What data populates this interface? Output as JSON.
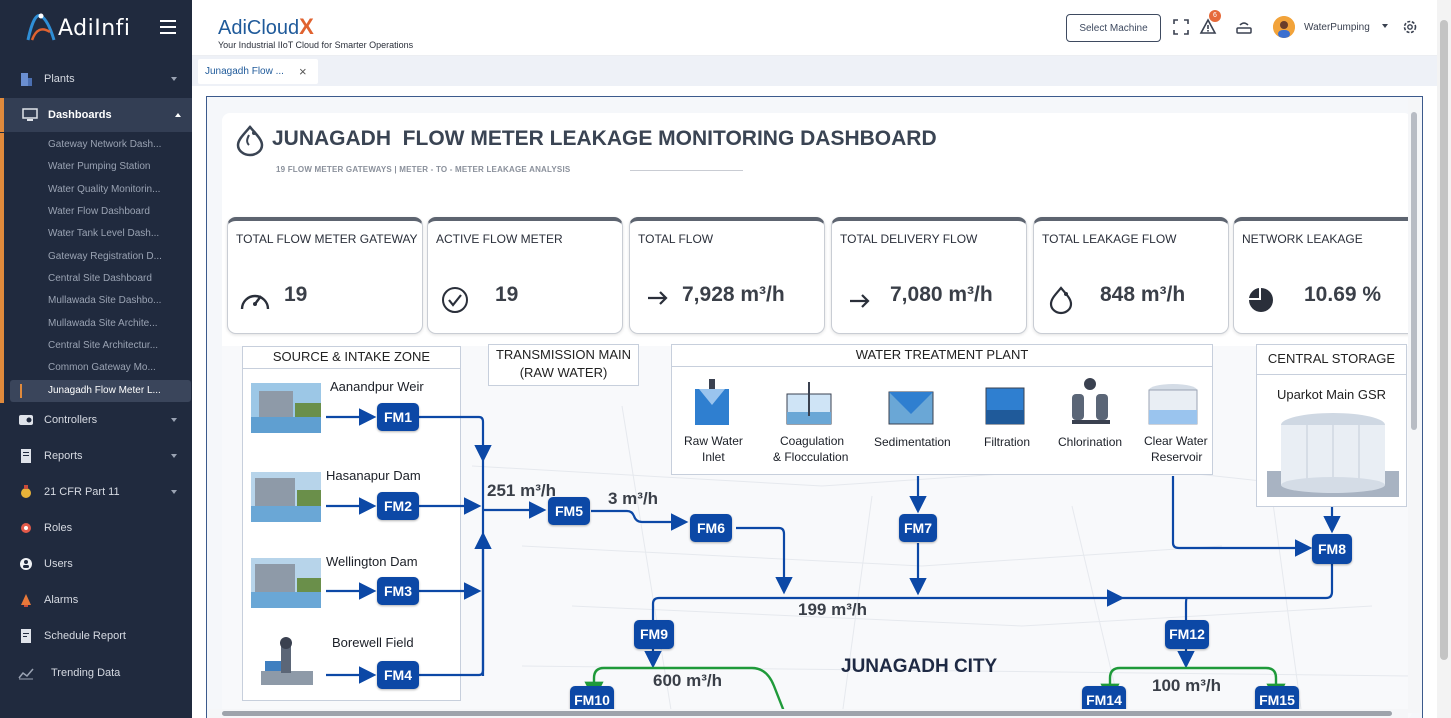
{
  "sidebar": {
    "logo_text": "AdiInfi",
    "items": [
      {
        "label": "Plants"
      },
      {
        "label": "Dashboards"
      },
      {
        "label": "Controllers"
      },
      {
        "label": "Reports"
      },
      {
        "label": "21 CFR Part 11"
      },
      {
        "label": "Roles"
      },
      {
        "label": "Users"
      },
      {
        "label": "Alarms"
      },
      {
        "label": "Schedule Report"
      },
      {
        "label": "Trending Data"
      }
    ],
    "dashboards": [
      "Gateway Network Dash...",
      "Water Pumping Station",
      "Water Quality Monitorin...",
      "Water Flow Dashboard",
      "Water Tank Level Dash...",
      "Gateway Registration D...",
      "Central Site Dashboard",
      "Mullawada Site Dashbo...",
      "Mullawada Site Archite...",
      "Central Site Architectur...",
      "Common Gateway Mo...",
      "Junagadh Flow Meter L..."
    ]
  },
  "header": {
    "brand": "AdiCloud",
    "brand_x": "X",
    "tagline": "Your Industrial IIoT Cloud for Smarter Operations",
    "select_machine": "Select Machine",
    "alert_count": "6",
    "user_name": "WaterPumping"
  },
  "tabs": [
    {
      "label": "Junagadh Flow ..."
    }
  ],
  "dashboard": {
    "title": "JUNAGADH  FLOW METER LEAKAGE MONITORING DASHBOARD",
    "subtitle": "19 FLOW METER GATEWAYS  | METER - TO - METER LEAKAGE ANALYSIS",
    "cards": [
      {
        "label": "TOTAL FLOW METER GATEWAY",
        "value": "19"
      },
      {
        "label": "ACTIVE FLOW METER",
        "value": "19"
      },
      {
        "label": "TOTAL FLOW",
        "value": "7,928 m³/h"
      },
      {
        "label": "TOTAL DELIVERY FLOW",
        "value": "7,080 m³/h"
      },
      {
        "label": "TOTAL LEAKAGE FLOW",
        "value": "848 m³/h"
      },
      {
        "label": "NETWORK LEAKAGE",
        "value": "10.69 %"
      }
    ]
  },
  "diagram": {
    "zones": {
      "source": "SOURCE & INTAKE ZONE",
      "transmission_1": "TRANSMISSION MAIN",
      "transmission_2": "(RAW WATER)",
      "wtp": "WATER TREATMENT PLANT",
      "storage": "CENTRAL STORAGE",
      "storage_name": "Uparkot Main GSR"
    },
    "sources": [
      "Aanandpur Weir",
      "Hasanapur Dam",
      "Wellington Dam",
      "Borewell Field"
    ],
    "wtp_steps": [
      {
        "l1": "Raw Water",
        "l2": "Inlet"
      },
      {
        "l1": "Coagulation",
        "l2": "& Flocculation"
      },
      {
        "l1": "Sedimentation",
        "l2": ""
      },
      {
        "l1": "Filtration",
        "l2": ""
      },
      {
        "l1": "Chlorination",
        "l2": ""
      },
      {
        "l1": "Clear Water",
        "l2": "Reservoir"
      }
    ],
    "meters": [
      "FM1",
      "FM2",
      "FM3",
      "FM4",
      "FM5",
      "FM6",
      "FM7",
      "FM8",
      "FM9",
      "FM12",
      "FM10",
      "FM14",
      "FM15"
    ],
    "flows": [
      "251 m³/h",
      "3 m³/h",
      "199 m³/h",
      "600 m³/h",
      "100 m³/h"
    ],
    "city": "JUNAGADH CITY"
  }
}
